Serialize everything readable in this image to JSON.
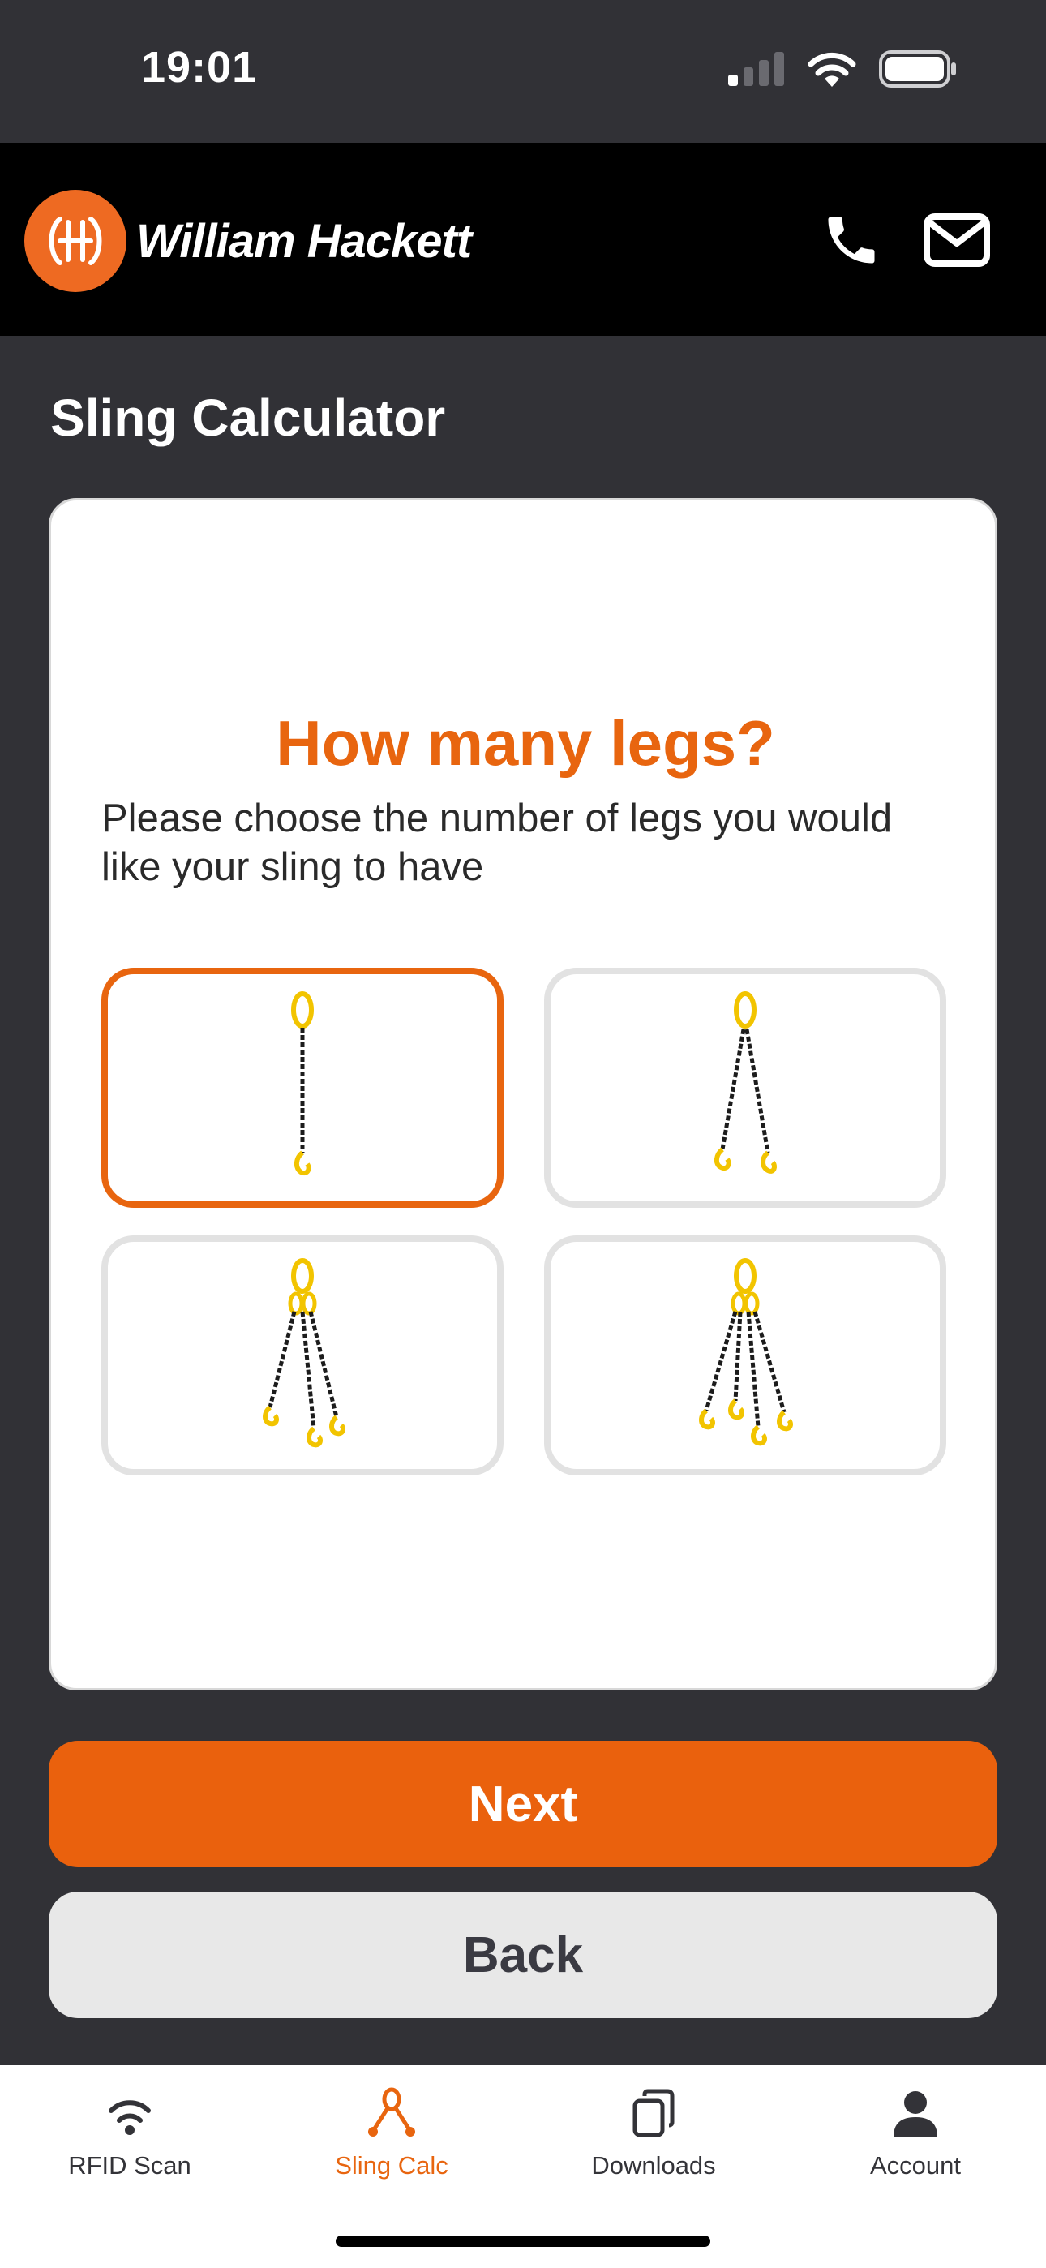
{
  "status_bar": {
    "time": "19:01"
  },
  "header": {
    "brand": "William Hackett"
  },
  "page": {
    "title": "Sling Calculator"
  },
  "card": {
    "heading": "How many legs?",
    "description": "Please choose the number of legs you would like your sling to have",
    "options": [
      {
        "legs": 1,
        "selected": true
      },
      {
        "legs": 2,
        "selected": false
      },
      {
        "legs": 3,
        "selected": false
      },
      {
        "legs": 4,
        "selected": false
      }
    ]
  },
  "buttons": {
    "next": "Next",
    "back": "Back"
  },
  "tabs": [
    {
      "label": "RFID Scan",
      "icon": "rfid-icon",
      "active": false
    },
    {
      "label": "Sling Calc",
      "icon": "sling-icon",
      "active": true
    },
    {
      "label": "Downloads",
      "icon": "downloads-icon",
      "active": false
    },
    {
      "label": "Account",
      "icon": "account-icon",
      "active": false
    }
  ],
  "colors": {
    "accent": "#e8650f",
    "background": "#313136",
    "header": "#000000"
  }
}
